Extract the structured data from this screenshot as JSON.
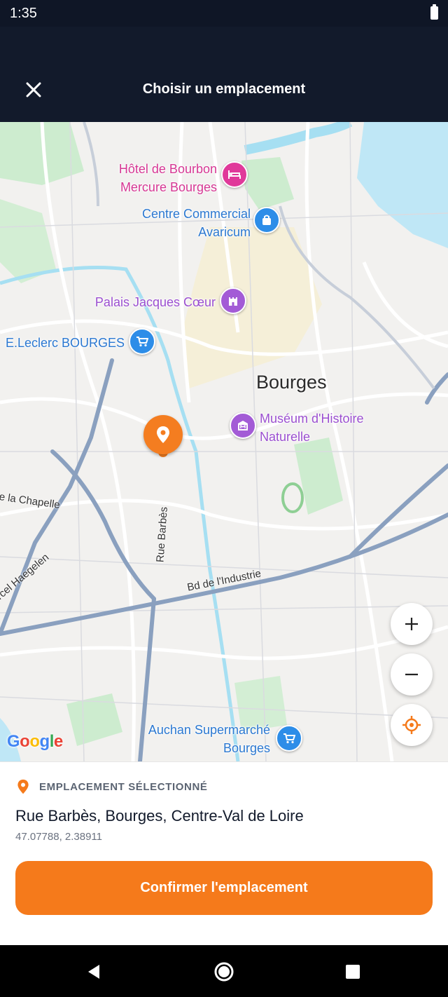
{
  "status_bar": {
    "time": "1:35"
  },
  "header": {
    "title": "Choisir un emplacement"
  },
  "map": {
    "city": "Bourges",
    "pois": [
      {
        "name": "Hôtel de Bourbon\nMercure Bourges",
        "line1": "Hôtel de Bourbon",
        "line2": "Mercure Bourges",
        "color": "#e0399a",
        "icon": "hotel-icon"
      },
      {
        "line1": "Centre Commercial",
        "line2": "Avaricum",
        "color": "#2d8de8",
        "icon": "shopping-bag-icon"
      },
      {
        "line1": "Palais Jacques Cœur",
        "color": "#a35bd6",
        "icon": "castle-icon"
      },
      {
        "line1": "E.Leclerc BOURGES",
        "color": "#2d8de8",
        "icon": "cart-icon"
      },
      {
        "line1": "Muséum d'Histoire",
        "line2": "Naturelle",
        "color": "#a35bd6",
        "icon": "museum-icon"
      },
      {
        "line1": "Auchan Supermarché",
        "line2": "Bourges",
        "color": "#2d8de8",
        "icon": "cart-icon"
      }
    ],
    "streets": {
      "chapelle": "e la Chapelle",
      "barbes": "Rue Barbès",
      "haegelen": "rcel Haegelen",
      "industrie": "Bd de l'Industrie"
    },
    "google_logo": [
      "G",
      "o",
      "o",
      "g",
      "l",
      "e"
    ],
    "pin_color": "#f47d20"
  },
  "sheet": {
    "selected_label": "EMPLACEMENT SÉLECTIONNÉ",
    "address": "Rue Barbès, Bourges, Centre-Val de Loire",
    "coordinates": "47.07788, 2.38911",
    "confirm_label": "Confirmer l'emplacement"
  },
  "colors": {
    "accent": "#f57a1b",
    "header_bg": "#121a2b"
  }
}
